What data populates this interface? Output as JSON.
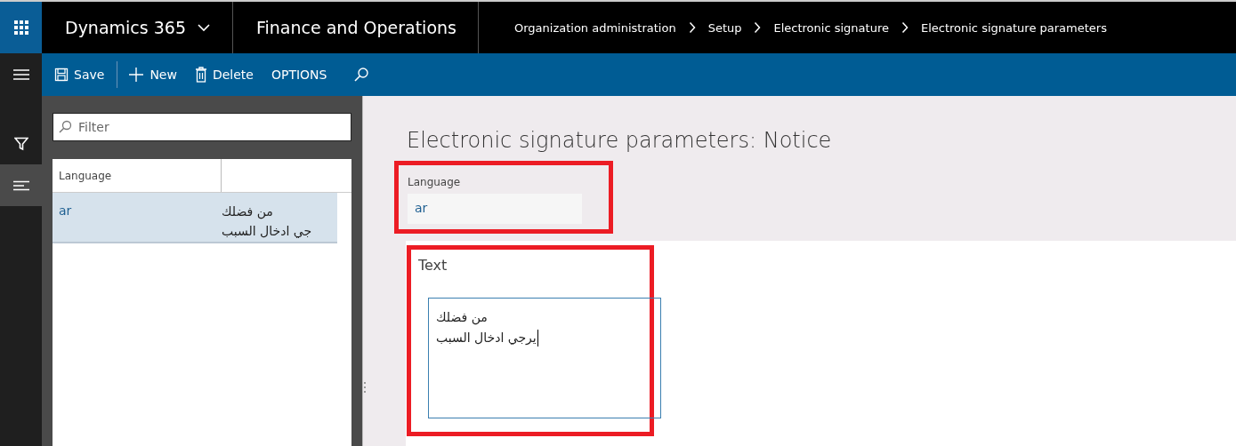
{
  "top_bar": {
    "app_name": "Dynamics 365",
    "module": "Finance and Operations",
    "breadcrumb": [
      "Organization administration",
      "Setup",
      "Electronic signature",
      "Electronic signature parameters"
    ]
  },
  "toolbar": {
    "buttons": [
      {
        "label": "Save",
        "kind": "save"
      },
      {
        "label": "New",
        "kind": "new"
      },
      {
        "label": "Delete",
        "kind": "delete"
      },
      {
        "label": "OPTIONS",
        "kind": "plain"
      }
    ]
  },
  "filter_pane": {
    "placeholder": "Filter",
    "grid": {
      "columns": [
        "Language"
      ],
      "rows": [
        {
          "selected": true,
          "language": "ar",
          "text_lines": [
            "من فضلك",
            "جي ادخال السبب"
          ]
        }
      ]
    }
  },
  "details": {
    "title": "Electronic signature parameters: Notice",
    "language": {
      "label": "Language",
      "value": "ar"
    },
    "text_section": {
      "label": "Text",
      "lines": [
        "من فضلك",
        "يرجي ادخال السبب"
      ]
    }
  }
}
